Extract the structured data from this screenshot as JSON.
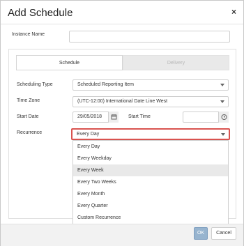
{
  "dialog": {
    "title": "Add Schedule",
    "close_icon": "×"
  },
  "instance": {
    "label": "Instance Name",
    "value": ""
  },
  "tabs": [
    {
      "label": "Schedule",
      "active": true
    },
    {
      "label": "Delivery",
      "active": false
    }
  ],
  "form": {
    "scheduling_type": {
      "label": "Scheduling Type",
      "value": "Scheduled Reporting Item"
    },
    "time_zone": {
      "label": "Time Zone",
      "value": "(UTC-12:00) International Date Line West"
    },
    "start_date": {
      "label": "Start Date",
      "value": "29/05/2018",
      "icon": "calendar-icon"
    },
    "start_time": {
      "label": "Start Time",
      "value": "",
      "icon": "clock-icon"
    },
    "recurrence": {
      "label": "Recurrence",
      "value": "Every Day"
    }
  },
  "recurrence_options": [
    "Every Day",
    "Every Weekday",
    "Every Week",
    "Every Two Weeks",
    "Every Month",
    "Every Quarter",
    "Custom Recurrence"
  ],
  "buttons": {
    "ok": "OK",
    "cancel": "Cancel"
  }
}
